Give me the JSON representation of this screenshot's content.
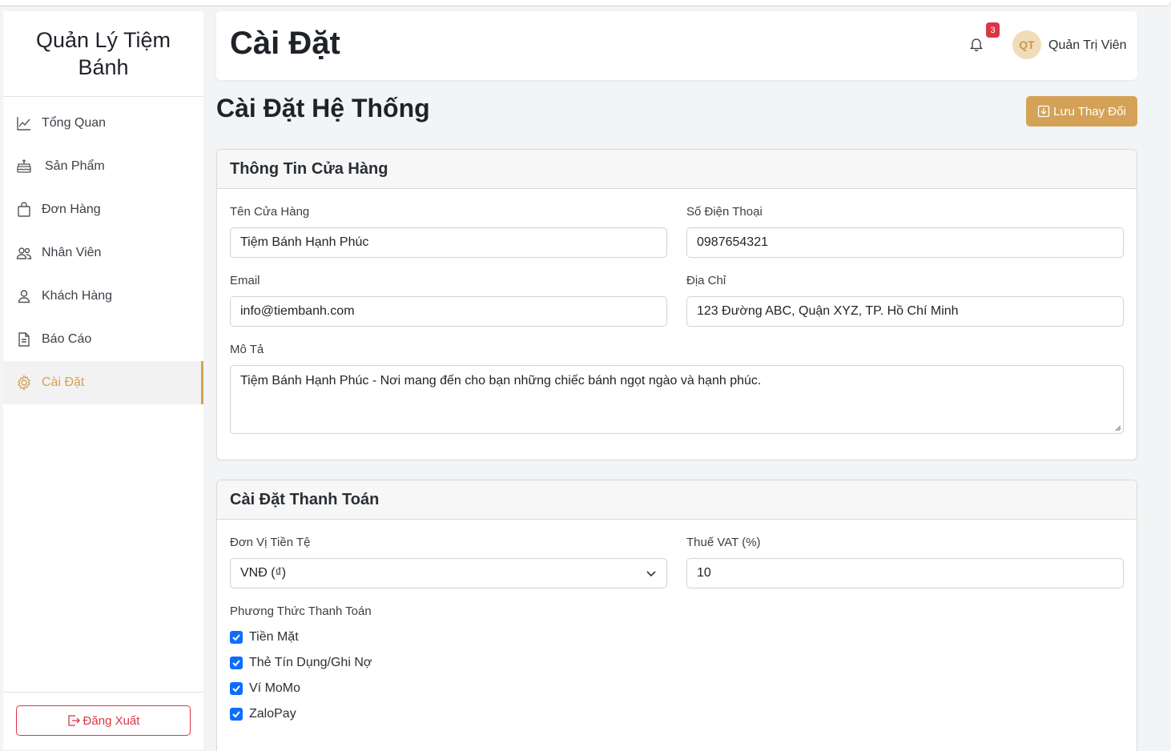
{
  "brand": {
    "title": "Quản Lý Tiệm Bánh"
  },
  "sidebar": {
    "items": [
      {
        "label": "Tổng Quan",
        "icon": "chart-line-icon"
      },
      {
        "label": "Sản Phẩm",
        "icon": "cake-icon"
      },
      {
        "label": "Đơn Hàng",
        "icon": "shopping-bag-icon"
      },
      {
        "label": "Nhân Viên",
        "icon": "people-icon"
      },
      {
        "label": "Khách Hàng",
        "icon": "person-icon"
      },
      {
        "label": "Báo Cáo",
        "icon": "document-icon"
      },
      {
        "label": "Cài Đặt",
        "icon": "gear-icon",
        "active": true
      }
    ],
    "logout_label": "Đăng Xuất"
  },
  "header": {
    "title": "Cài Đặt",
    "notification_count": "3",
    "avatar_initials": "QT",
    "username": "Quản Trị Viên"
  },
  "main": {
    "title": "Cài Đặt Hệ Thống",
    "save_label": "Lưu Thay Đổi"
  },
  "store_info": {
    "title": "Thông Tin Cửa Hàng",
    "name_label": "Tên Cửa Hàng",
    "name_value": "Tiệm Bánh Hạnh Phúc",
    "phone_label": "Số Điện Thoại",
    "phone_value": "0987654321",
    "email_label": "Email",
    "email_value": "info@tiembanh.com",
    "address_label": "Địa Chỉ",
    "address_value": "123 Đường ABC, Quận XYZ, TP. Hồ Chí Minh",
    "desc_label": "Mô Tả",
    "desc_value": "Tiệm Bánh Hạnh Phúc - Nơi mang đến cho bạn những chiếc bánh ngọt ngào và hạnh phúc."
  },
  "payment": {
    "title": "Cài Đặt Thanh Toán",
    "currency_label": "Đơn Vị Tiền Tệ",
    "currency_value": "VNĐ (₫)",
    "vat_label": "Thuế VAT (%)",
    "vat_value": "10",
    "methods_label": "Phương Thức Thanh Toán",
    "methods": [
      {
        "label": "Tiền Mặt",
        "checked": true
      },
      {
        "label": "Thẻ Tín Dụng/Ghi Nợ",
        "checked": true
      },
      {
        "label": "Ví MoMo",
        "checked": true
      },
      {
        "label": "ZaloPay",
        "checked": true
      }
    ]
  },
  "colors": {
    "accent": "#d4a257",
    "danger": "#dc3545",
    "checkbox": "#0d6efd"
  }
}
